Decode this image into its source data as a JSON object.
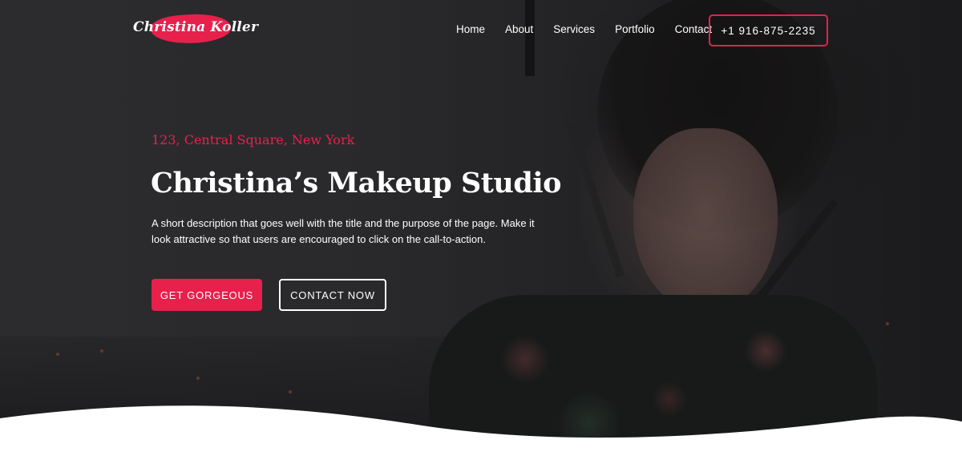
{
  "brand": {
    "logo_text": "Christina Koller",
    "accent_color": "#e8204c"
  },
  "nav": {
    "items": [
      {
        "label": "Home"
      },
      {
        "label": "About"
      },
      {
        "label": "Services"
      },
      {
        "label": "Portfolio"
      },
      {
        "label": "Contact"
      }
    ],
    "phone": "+1 916-875-2235"
  },
  "hero": {
    "address": "123, Central Square, New York",
    "title": "Christina’s Makeup Studio",
    "description": "A short description that goes well with the title and the purpose of the page. Make it look attractive so that users are encouraged to click on the call-to-action.",
    "primary_button": "GET GORGEOUS",
    "secondary_button": "CONTACT NOW"
  }
}
